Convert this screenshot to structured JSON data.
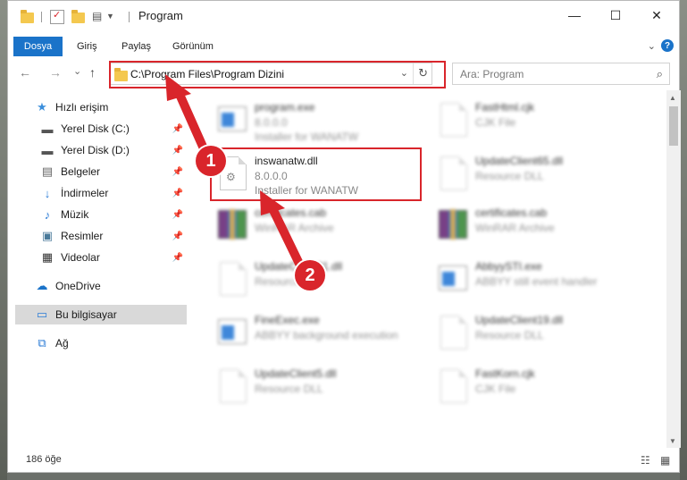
{
  "window": {
    "title": "Program"
  },
  "ribbon": {
    "tabs": [
      "Dosya",
      "Giriş",
      "Paylaş",
      "Görünüm"
    ],
    "help": "?"
  },
  "window_controls": {
    "minimize": "—",
    "maximize": "☐",
    "close": "✕"
  },
  "navigation": {
    "back": "←",
    "forward": "→",
    "recent": "⌄",
    "up": "↑",
    "address": "C:\\Program Files\\Program Dizini",
    "dropdown": "⌄",
    "refresh": "↻",
    "search_placeholder": "Ara: Program",
    "search_icon": "⌕"
  },
  "sidebar": {
    "items": [
      {
        "label": "Hızlı erişim",
        "icon": "star-icon",
        "pinned": false
      },
      {
        "label": "Yerel Disk (C:)",
        "icon": "drive-icon",
        "pinned": true
      },
      {
        "label": "Yerel Disk (D:)",
        "icon": "drive-icon",
        "pinned": true
      },
      {
        "label": "Belgeler",
        "icon": "documents-icon",
        "pinned": true
      },
      {
        "label": "İndirmeler",
        "icon": "download-icon",
        "pinned": true
      },
      {
        "label": "Müzik",
        "icon": "music-icon",
        "pinned": true
      },
      {
        "label": "Resimler",
        "icon": "pictures-icon",
        "pinned": true
      },
      {
        "label": "Videolar",
        "icon": "videos-icon",
        "pinned": true
      },
      {
        "label": "OneDrive",
        "icon": "cloud-icon",
        "pinned": false
      },
      {
        "label": "Bu bilgisayar",
        "icon": "computer-icon",
        "pinned": false
      },
      {
        "label": "Ağ",
        "icon": "network-icon",
        "pinned": false
      }
    ]
  },
  "files": {
    "left": [
      {
        "name": "program.exe",
        "line1": "8.0.0.0",
        "line2": "Installer for WANATW"
      },
      {
        "name": "inswanatw.dll",
        "line1": "8.0.0.0",
        "line2": "Installer for WANATW"
      },
      {
        "name": "certificates.cab",
        "line1": "WinRAR Archive",
        "line2": ""
      },
      {
        "name": "UpdateClient21.dll",
        "line1": "Resource DLL",
        "line2": ""
      },
      {
        "name": "FineExec.exe",
        "line1": "ABBYY background execution",
        "line2": ""
      },
      {
        "name": "UpdateClient5.dll",
        "line1": "Resource DLL",
        "line2": ""
      }
    ],
    "right": [
      {
        "name": "FastHtml.cjk",
        "line1": "CJK File",
        "line2": ""
      },
      {
        "name": "UpdateClient65.dll",
        "line1": "Resource DLL",
        "line2": ""
      },
      {
        "name": "certificates.cab",
        "line1": "WinRAR Archive",
        "line2": ""
      },
      {
        "name": "AbbyySTI.exe",
        "line1": "ABBYY still event handler",
        "line2": ""
      },
      {
        "name": "UpdateClient19.dll",
        "line1": "Resource DLL",
        "line2": ""
      },
      {
        "name": "FastKorn.cjk",
        "line1": "CJK File",
        "line2": ""
      }
    ]
  },
  "status": {
    "count": "186 öğe",
    "details_view": "☷",
    "icons_view": "▦"
  },
  "callouts": [
    "1",
    "2"
  ],
  "colors": {
    "accent": "#1a73c9",
    "highlight": "#d9252b",
    "selected": "#d9d9d9"
  }
}
